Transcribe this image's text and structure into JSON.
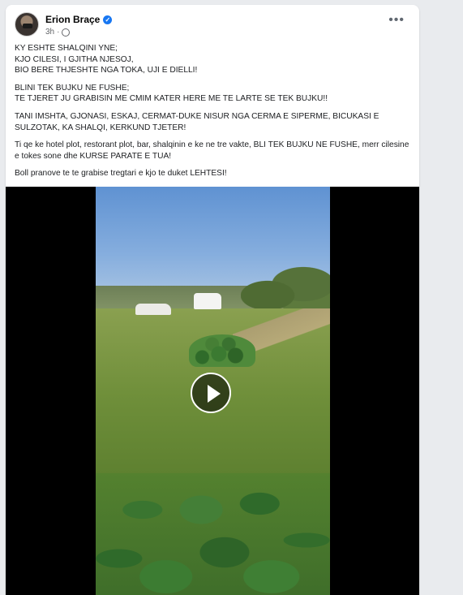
{
  "post": {
    "author": "Erion Braçe",
    "time": "3h",
    "verified_icon": "verified-badge-icon",
    "privacy_icon": "globe-icon",
    "more_label": "•••",
    "text": {
      "p1_l1": "KY ESHTE SHALQINI YNE;",
      "p1_l2": "KJO CILESI, I GJITHA NJESOJ,",
      "p1_l3": "BIO BERE THJESHTE NGA TOKA, UJI E DIELLI!",
      "p2_l1": "BLINI TEK BUJKU NE FUSHE;",
      "p2_l2": "TE TJERET JU GRABISIN ME CMIM KATER HERE ME TE LARTE SE TEK BUJKU!!",
      "p3": "TANI IMSHTA, GJONASI, ESKAJ, CERMAT-DUKE NISUR NGA CERMA E SIPERME, BICUKASI E SULZOTAK, KA SHALQI, KERKUND TJETER!",
      "p4": "Ti qe ke hotel plot, restorant plot, bar, shalqinin e ke ne tre vakte, BLI TEK BUJKU NE FUSHE, merr cilesine e tokes sone dhe KURSE PARATE E TUA!",
      "p5": "Boll pranove te te grabise tregtari e kjo te duket LEHTESI!"
    },
    "video": {
      "play_icon": "play-icon"
    }
  }
}
